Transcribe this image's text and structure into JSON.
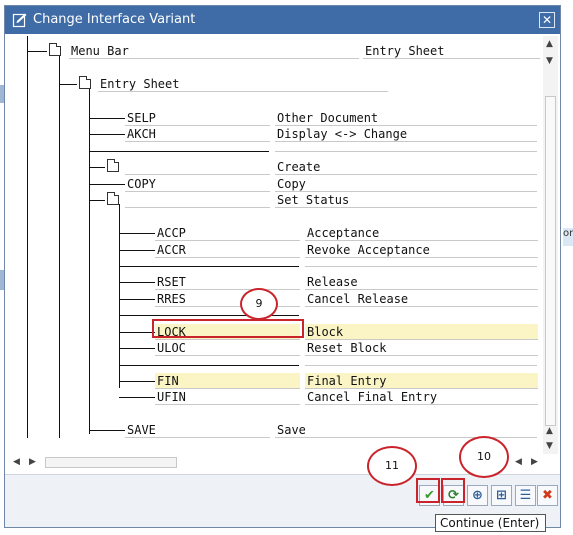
{
  "dialog": {
    "title": "Change Interface Variant",
    "close_label": "✕"
  },
  "tree": {
    "menu_bar": {
      "label": "Menu Bar",
      "value": "Entry Sheet"
    },
    "entry_sheet": {
      "label": "Entry Sheet"
    },
    "rows": [
      {
        "code": "SELP",
        "text": "Other Document"
      },
      {
        "code": "AKCH",
        "text": "Display <-> Change"
      },
      {
        "code": "",
        "text": "Create"
      },
      {
        "code": "COPY",
        "text": "Copy"
      },
      {
        "code": "",
        "text": "Set Status"
      },
      {
        "code": "ACCP",
        "text": "Acceptance"
      },
      {
        "code": "ACCR",
        "text": "Revoke Acceptance"
      },
      {
        "code": "RSET",
        "text": "Release"
      },
      {
        "code": "RRES",
        "text": "Cancel Release"
      },
      {
        "code": "LOCK",
        "text": "Block"
      },
      {
        "code": "ULOC",
        "text": "Reset Block"
      },
      {
        "code": "FIN",
        "text": "Final Entry"
      },
      {
        "code": "UFIN",
        "text": "Cancel Final Entry"
      },
      {
        "code": "SAVE",
        "text": "Save"
      }
    ]
  },
  "footer": {
    "tooltip": "Continue  (Enter)",
    "buttons": [
      "✔",
      "⟳",
      "⊕",
      "⊞",
      "☰",
      "✖"
    ]
  },
  "callouts": [
    "9",
    "11",
    "10"
  ],
  "colors": {
    "titlebar": "#3f6ca6",
    "highlight": "#fbf5c5",
    "callout": "#c9242b"
  }
}
